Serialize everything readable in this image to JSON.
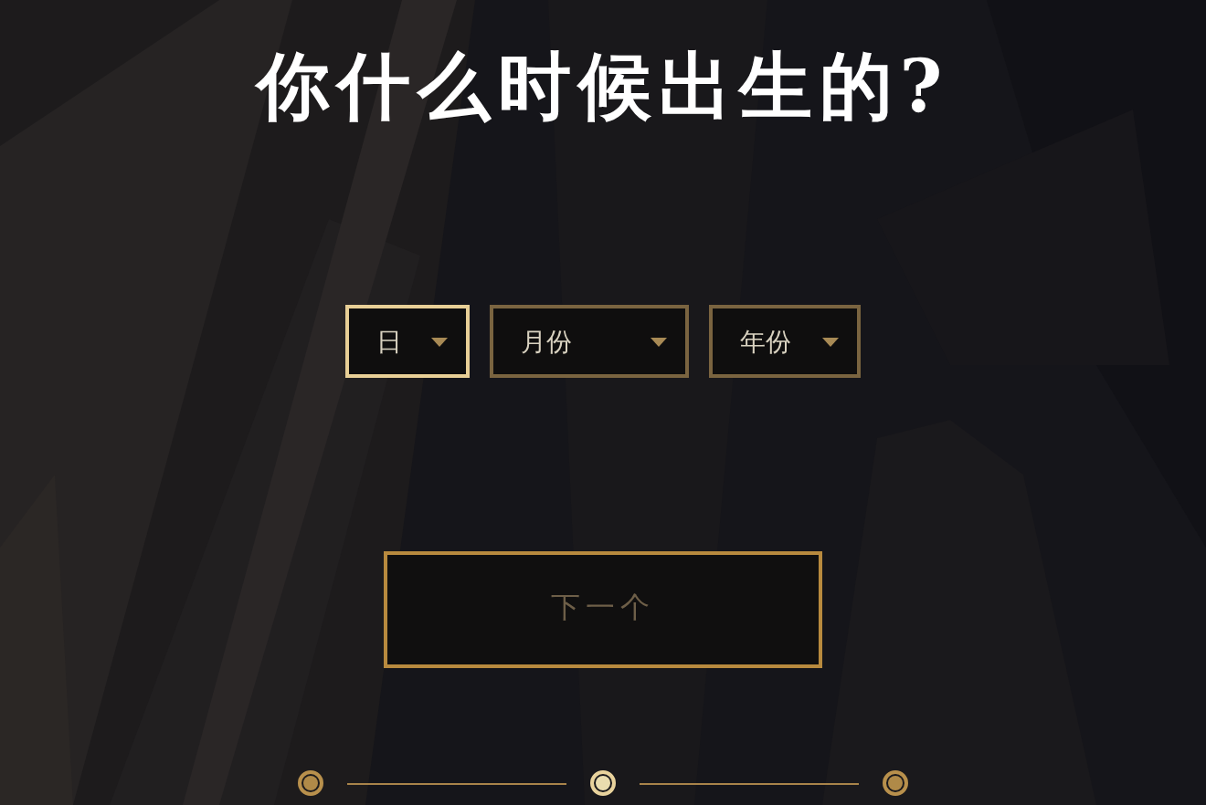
{
  "title": "你什么时候出生的?",
  "dropdowns": [
    {
      "label": "日",
      "selected": true
    },
    {
      "label": "月份",
      "selected": false
    },
    {
      "label": "年份",
      "selected": false
    }
  ],
  "next_button": {
    "label": "下一个",
    "disabled": true
  },
  "steps": [
    {
      "selected": false
    },
    {
      "selected": true
    },
    {
      "selected": false
    }
  ]
}
